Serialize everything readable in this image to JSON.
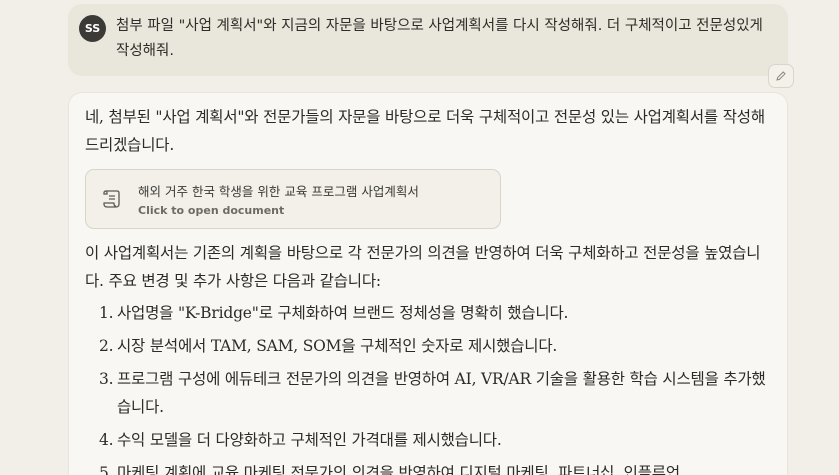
{
  "user": {
    "avatar_initials": "SS",
    "message": "첨부 파일 \"사업 계획서\"와 지금의 자문을  바탕으로 사업계획서를 다시 작성해줘. 더 구체적이고 전문성있게 작성해줘."
  },
  "icons": {
    "edit": "pencil-icon",
    "document": "scroll-document-icon"
  },
  "assistant": {
    "intro": "네, 첨부된 \"사업 계획서\"와 전문가들의 자문을 바탕으로 더욱 구체적이고 전문성 있는 사업계획서를 작성해 드리겠습니다.",
    "document": {
      "title": "해외 거주 한국 학생을 위한 교육 프로그램 사업계획서",
      "action": "Click to open document"
    },
    "summary": "이 사업계획서는 기존의 계획을 바탕으로 각 전문가의 의견을 반영하여 더욱 구체화하고 전문성을 높였습니다. 주요 변경 및 추가 사항은 다음과 같습니다:",
    "changes": [
      {
        "num": "1.",
        "text": "사업명을 \"K-Bridge\"로 구체화하여 브랜드 정체성을 명확히 했습니다."
      },
      {
        "num": "2.",
        "text": "시장 분석에서 TAM, SAM, SOM을 구체적인 숫자로 제시했습니다."
      },
      {
        "num": "3.",
        "text": "프로그램 구성에 에듀테크 전문가의 의견을 반영하여 AI, VR/AR 기술을 활용한 학습 시스템을 추가했습니다."
      },
      {
        "num": "4.",
        "text": "수익 모델을 더 다양화하고 구체적인 가격대를 제시했습니다."
      },
      {
        "num": "5.",
        "text": "마케팅 계획에 교육 마케팅 전문가의 의견을 반영하여 디지털 마케팅, 파트너십, 인플루언"
      }
    ]
  }
}
